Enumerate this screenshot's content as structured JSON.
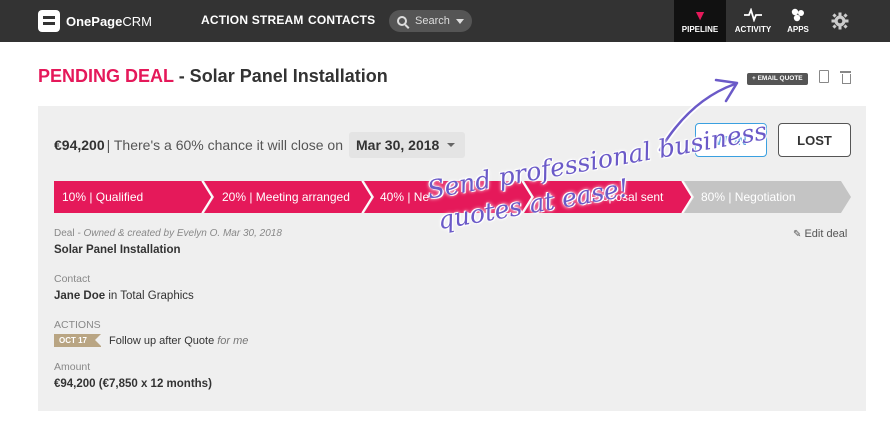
{
  "app": {
    "logo_bold": "OnePage",
    "logo_light": "CRM"
  },
  "nav": {
    "action_stream": "ACTION STREAM",
    "contacts": "CONTACTS",
    "search_placeholder": "Search",
    "pipeline": "PIPELINE",
    "activity": "ACTIVITY",
    "apps": "APPS"
  },
  "deal": {
    "status": "PENDING DEAL",
    "name_suffix": " - Solar Panel Installation",
    "email_quote": "+ EMAIL QUOTE",
    "amount": "€94,200",
    "chance_text": " | There's a 60% chance it will close on",
    "close_date": "Mar 30, 2018",
    "won_label": "WON",
    "lost_label": "LOST",
    "stages": [
      {
        "label": "10% | Qualified",
        "state": "done"
      },
      {
        "label": "20% | Meeting arranged",
        "state": "done"
      },
      {
        "label": "40% | Ne",
        "state": "done"
      },
      {
        "label": "Proposal sent",
        "state": "current"
      },
      {
        "label": "80% | Negotiation",
        "state": "todo"
      }
    ],
    "meta_label": "Deal",
    "meta_owner": " - Owned & created by Evelyn O. Mar 30, 2018",
    "edit_label": "Edit deal",
    "deal_name": "Solar Panel Installation",
    "contact_label": "Contact",
    "contact_name": "Jane Doe",
    "contact_company": " in Total Graphics",
    "actions_label": "ACTIONS",
    "action_date": "OCT 17",
    "action_text": "Follow up after Quote ",
    "action_assignee": "for me",
    "amount_label": "Amount",
    "amount_detail": "€94,200 (€7,850 x 12 months)"
  },
  "promo": {
    "line1": "Send professional business",
    "line2": "quotes at ease!"
  },
  "colors": {
    "accent": "#e5195a",
    "topbar": "#333333",
    "stage_todo": "#c4c4c4",
    "promo": "#6b5ac8",
    "won": "#3a8fd8"
  }
}
